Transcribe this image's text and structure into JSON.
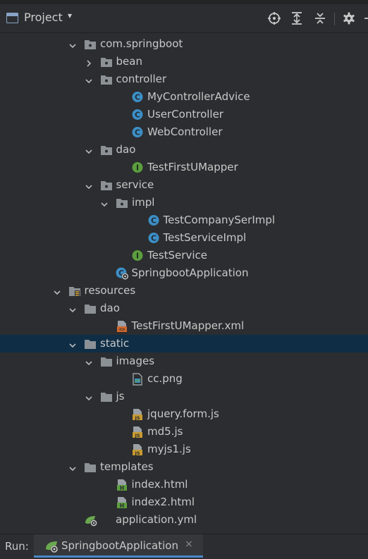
{
  "header": {
    "title": "Project",
    "caret": "▾",
    "tools": [
      "locate-icon",
      "expand-all-icon",
      "collapse-all-icon",
      "settings-icon"
    ]
  },
  "tree": [
    {
      "name": "com.springboot",
      "icon": "package",
      "arrow": "down",
      "level": 0
    },
    {
      "name": "bean",
      "icon": "package",
      "arrow": "right",
      "level": 1
    },
    {
      "name": "controller",
      "icon": "package",
      "arrow": "down",
      "level": 1
    },
    {
      "name": "MyControllerAdvice",
      "icon": "class",
      "arrow": "none",
      "level": 2
    },
    {
      "name": "UserController",
      "icon": "class",
      "arrow": "none",
      "level": 2
    },
    {
      "name": "WebController",
      "icon": "class",
      "arrow": "none",
      "level": 2
    },
    {
      "name": "dao",
      "icon": "package",
      "arrow": "down",
      "level": 1
    },
    {
      "name": "TestFirstUMapper",
      "icon": "interface",
      "arrow": "none",
      "level": 2
    },
    {
      "name": "service",
      "icon": "package",
      "arrow": "down",
      "level": 1
    },
    {
      "name": "impl",
      "icon": "package",
      "arrow": "down",
      "level": 2
    },
    {
      "name": "TestCompanySerImpl",
      "icon": "class",
      "arrow": "none",
      "level": 3
    },
    {
      "name": "TestServiceImpl",
      "icon": "class",
      "arrow": "none",
      "level": 3
    },
    {
      "name": "TestService",
      "icon": "interface",
      "arrow": "none",
      "level": 2
    },
    {
      "name": "SpringbootApplication",
      "icon": "springclass",
      "arrow": "none",
      "level": 1
    },
    {
      "name": "resources",
      "icon": "resources",
      "arrow": "down",
      "level": -1
    },
    {
      "name": "dao",
      "icon": "folder",
      "arrow": "down",
      "level": 0
    },
    {
      "name": "TestFirstUMapper.xml",
      "icon": "xml",
      "arrow": "none",
      "level": 1
    },
    {
      "name": "static",
      "icon": "folder",
      "arrow": "down",
      "level": 0,
      "selected": true
    },
    {
      "name": "images",
      "icon": "folder",
      "arrow": "down",
      "level": 1
    },
    {
      "name": "cc.png",
      "icon": "image",
      "arrow": "none",
      "level": 2
    },
    {
      "name": "js",
      "icon": "folder",
      "arrow": "down",
      "level": 1
    },
    {
      "name": "jquery.form.js",
      "icon": "js",
      "arrow": "none",
      "level": 2
    },
    {
      "name": "md5.js",
      "icon": "js",
      "arrow": "none",
      "level": 2
    },
    {
      "name": "myjs1.js",
      "icon": "js",
      "arrow": "none",
      "level": 2
    },
    {
      "name": "templates",
      "icon": "folder",
      "arrow": "down",
      "level": 0
    },
    {
      "name": "index.html",
      "icon": "html",
      "arrow": "none",
      "level": 1
    },
    {
      "name": "index2.html",
      "icon": "html",
      "arrow": "none",
      "level": 1
    },
    {
      "name": "application.yml",
      "icon": "yml",
      "arrow": "none",
      "level": 0
    }
  ],
  "run": {
    "label": "Run:",
    "tab_label": "SpringbootApplication",
    "close": "×"
  },
  "colors": {
    "background": "#2b2d30",
    "selection": "#0f2e46",
    "class_icon": "#3d8fc6",
    "interface_icon": "#5c9e3e",
    "folder_icon": "#8c9196",
    "js_icon": "#c79a2f",
    "xml_icon": "#d0662c",
    "html_icon": "#5c9e3e",
    "accent": "#4a88c7"
  }
}
